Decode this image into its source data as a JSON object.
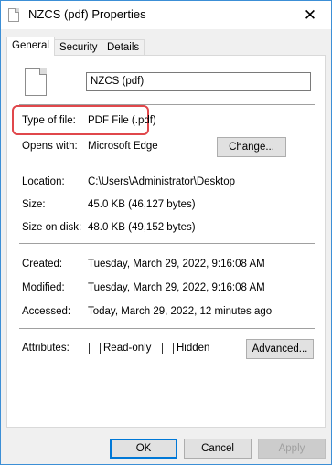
{
  "window": {
    "title": "NZCS (pdf) Properties",
    "close_glyph": "✕"
  },
  "tabs": [
    {
      "label": "General",
      "active": true
    },
    {
      "label": "Security",
      "active": false
    },
    {
      "label": "Details",
      "active": false
    }
  ],
  "general": {
    "file_name": "NZCS (pdf)",
    "type_label": "Type of file:",
    "type_value": "PDF File (.pdf)",
    "opens_label": "Opens with:",
    "opens_value": "Microsoft Edge",
    "change_button": "Change...",
    "location_label": "Location:",
    "location_value": "C:\\Users\\Administrator\\Desktop",
    "size_label": "Size:",
    "size_value": "45.0 KB (46,127 bytes)",
    "size_on_disk_label": "Size on disk:",
    "size_on_disk_value": "48.0 KB (49,152 bytes)",
    "created_label": "Created:",
    "created_value": "Tuesday, March 29, 2022, 9:16:08 AM",
    "modified_label": "Modified:",
    "modified_value": "Tuesday, March 29, 2022, 9:16:08 AM",
    "accessed_label": "Accessed:",
    "accessed_value": "Today, March 29, 2022, 12 minutes ago",
    "attributes_label": "Attributes:",
    "readonly_label": "Read-only",
    "readonly_checked": false,
    "hidden_label": "Hidden",
    "hidden_checked": false,
    "advanced_button": "Advanced..."
  },
  "footer": {
    "ok": "OK",
    "cancel": "Cancel",
    "apply": "Apply"
  },
  "colors": {
    "highlight": "#e0474b",
    "accent": "#0078d7"
  }
}
